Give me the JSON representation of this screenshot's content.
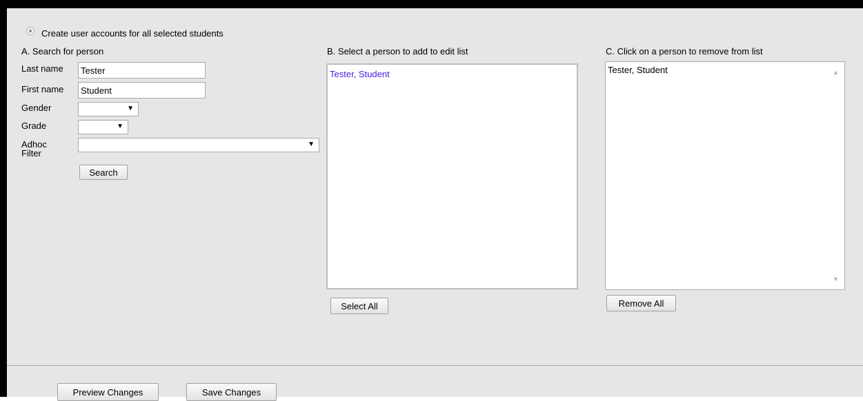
{
  "option": {
    "label": "Create user accounts for all selected students"
  },
  "section_a": {
    "title": "A. Search for person",
    "last_name_label": "Last name",
    "last_name_value": "Tester",
    "first_name_label": "First name",
    "first_name_value": "Student",
    "gender_label": "Gender",
    "grade_label": "Grade",
    "adhoc_label_line1": "Adhoc",
    "adhoc_label_line2": "Filter",
    "search_button": "Search"
  },
  "section_b": {
    "title": "B. Select a person to add to edit list",
    "items": [
      "Tester, Student"
    ],
    "select_all_button": "Select All",
    "item_color": "#4a1fe0"
  },
  "section_c": {
    "title": "C. Click on a person to remove from list",
    "items": [
      "Tester, Student"
    ],
    "remove_all_button": "Remove All"
  },
  "footer": {
    "preview_button": "Preview Changes",
    "save_button": "Save Changes"
  },
  "icons": {
    "dropdown": "▼",
    "scroll_up": "▲",
    "scroll_down": "▼"
  }
}
